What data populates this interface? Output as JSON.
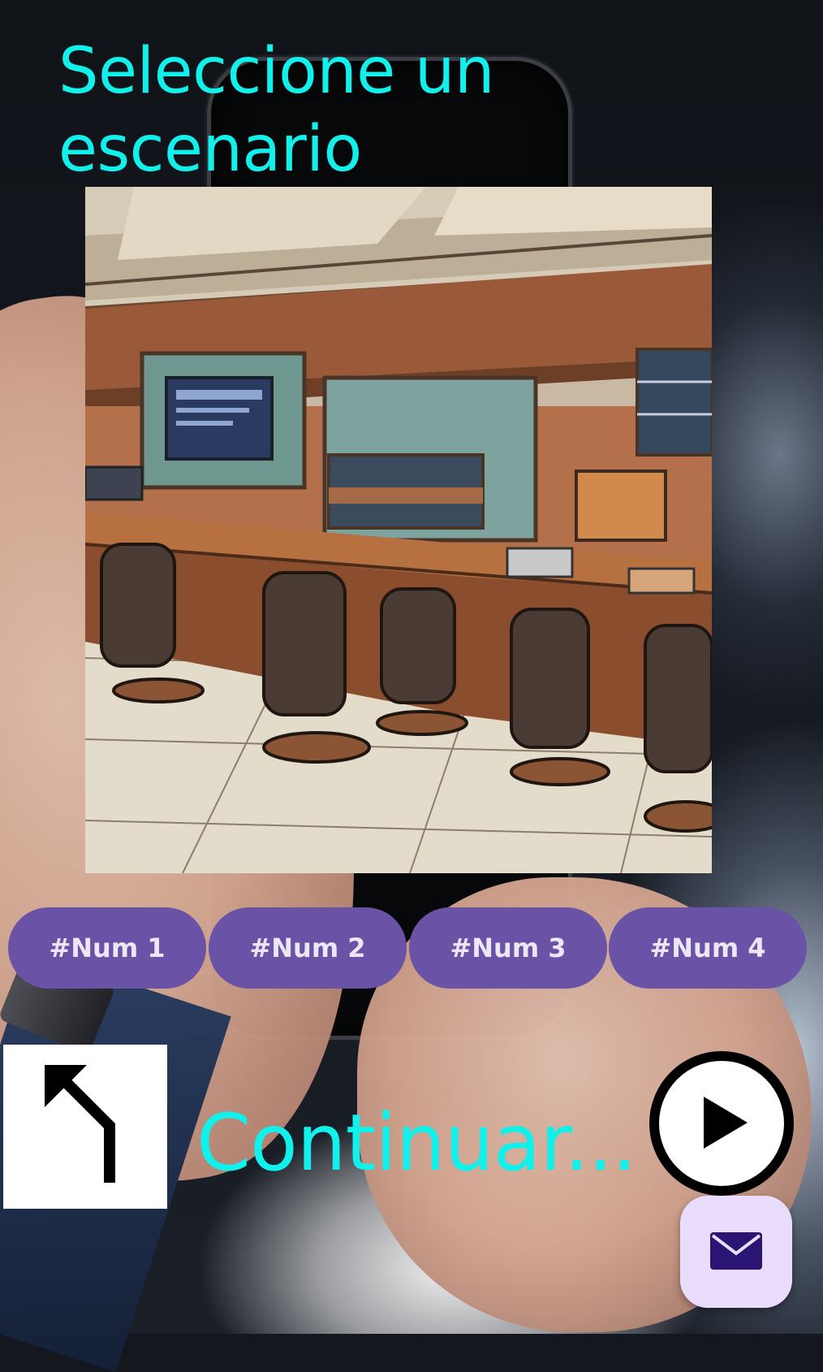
{
  "header": {
    "title": "Seleccione un escenario"
  },
  "scenario_image": {
    "alt": "Sala de reuniones"
  },
  "scenario_buttons": [
    {
      "label": "#Num 1"
    },
    {
      "label": "#Num 2"
    },
    {
      "label": "#Num 3"
    },
    {
      "label": "#Num 4"
    }
  ],
  "footer": {
    "back_icon": "turn-up-left-arrow-icon",
    "continue_label": "Continuar...",
    "play_icon": "play-circle-icon",
    "mail_icon": "mail-icon"
  },
  "colors": {
    "accent_text": "#12f0ec",
    "chip_background": "#6a52a6",
    "chip_text": "#ece6f7",
    "fab_background": "#eadcfc",
    "fab_icon": "#2a1572"
  }
}
